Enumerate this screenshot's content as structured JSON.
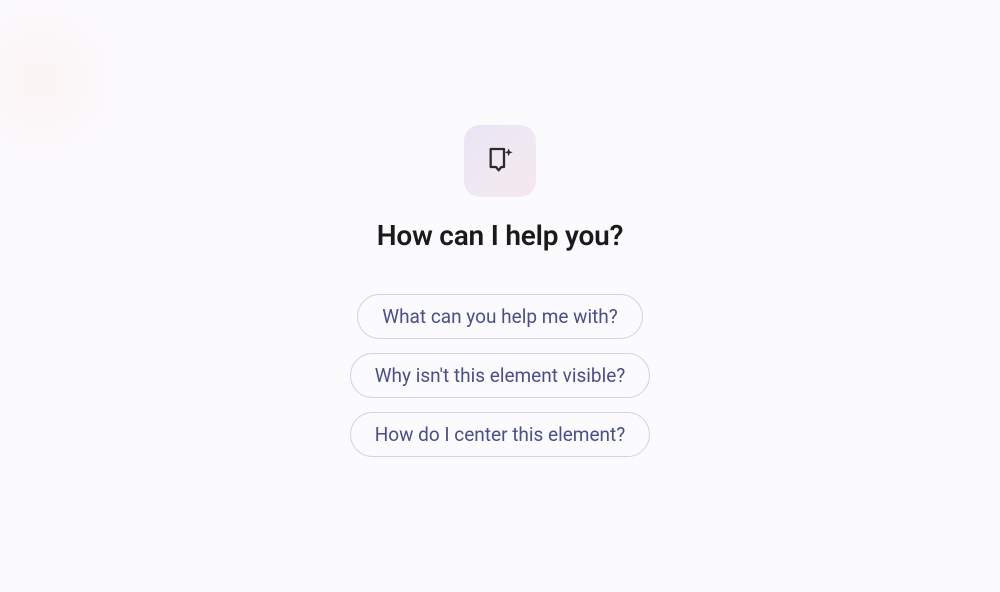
{
  "icon": "chat-sparkle-icon",
  "heading": "How can I help you?",
  "suggestions": [
    "What can you help me with?",
    "Why isn't this element visible?",
    "How do I center this element?"
  ]
}
